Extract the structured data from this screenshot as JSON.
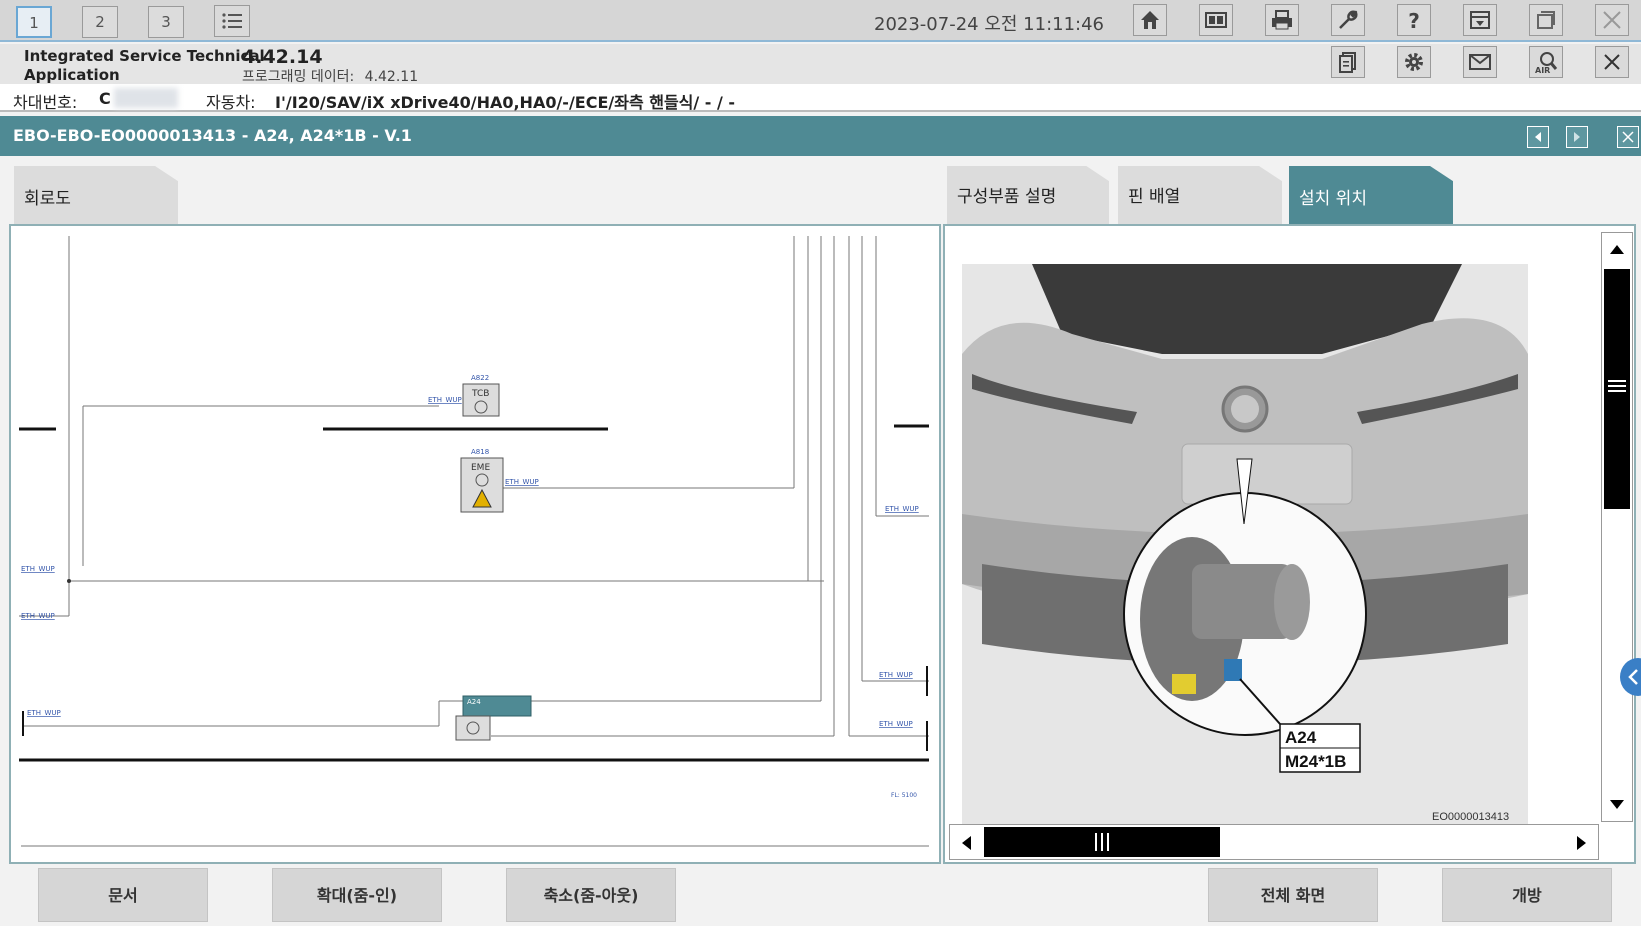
{
  "topbar": {
    "tabs": [
      "1",
      "2",
      "3"
    ],
    "datetime": "2023-07-24 오전 11:11:46",
    "icons_row1": [
      "home-icon",
      "compare-icon",
      "print-icon",
      "wrench-icon",
      "help-icon",
      "dropdown-menu-icon",
      "window-icon",
      "close-icon"
    ],
    "icons_row2": [
      "document-icon",
      "gear-icon",
      "mail-icon",
      "air-icon",
      "close-icon"
    ]
  },
  "app": {
    "name_line1": "Integrated Service Technical",
    "name_line2": "Application",
    "version": "4.42.14",
    "programming_label": "프로그래밍 데이터:",
    "programming_version": "4.42.11"
  },
  "vehicle": {
    "vin_label": "차대번호:",
    "vin_value": "C",
    "vehicle_label": "자동차:",
    "vehicle_value": "I'/I20/SAV/iX xDrive40/HA0,HA0/-/ECE/좌측 핸들식/ - / -"
  },
  "document": {
    "title": "EBO-EBO-EO0000013413 - A24, A24*1B - V.1"
  },
  "tabs": {
    "circuit": "회로도",
    "component_desc": "구성부품 설명",
    "pin_assignment": "핀 배열",
    "install_location": "설치 위치"
  },
  "diagram": {
    "label_a822": "A822",
    "label_tcb": "TCB",
    "label_a818": "A818",
    "label_eme": "EME",
    "label_a24": "A24",
    "wire_label": "ETH_WUP",
    "page_label": "FL: 5100"
  },
  "photo": {
    "callout_line1": "A24",
    "callout_line2": "M24*1B",
    "image_id": "EO0000013413"
  },
  "footer": {
    "document": "문서",
    "zoom_in": "확대(줌-인)",
    "zoom_out": "축소(줌-아웃)",
    "fullscreen": "전체 화면",
    "open": "개방"
  },
  "colors": {
    "teal": "#4f8a94",
    "scrollbar": "#000000"
  }
}
